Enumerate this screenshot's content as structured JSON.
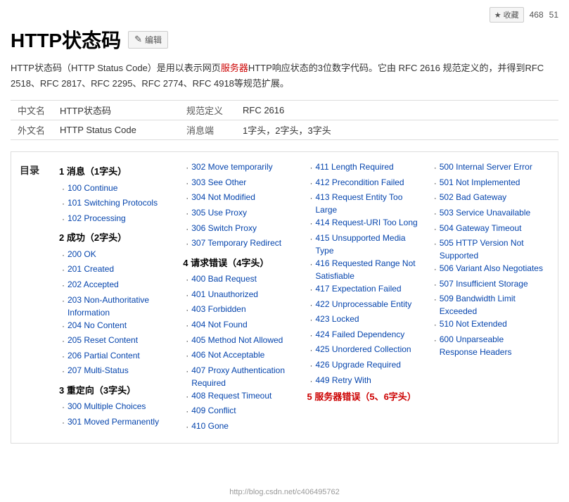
{
  "topbar": {
    "collect_label": "收藏",
    "collect_count": "468",
    "comment_count": "51"
  },
  "header": {
    "title": "HTTP状态码",
    "edit_label": "编辑"
  },
  "description": {
    "text1": "HTTP状态码（HTTP Status Code）是用以表示网页",
    "server_link": "服务器",
    "text2": "HTTP响应状态的3位数字代码。它由 RFC 2616 规范定义的，并得到RFC 2518、RFC 2817、RFC 2295、RFC 2774、RFC 4918等规范扩展。"
  },
  "info_rows": [
    {
      "label": "中文名",
      "value": "HTTP状态码",
      "meta_label": "规范定义",
      "meta_value": "RFC 2616"
    },
    {
      "label": "外文名",
      "value": "HTTP Status Code",
      "meta_label": "消息端",
      "meta_value": "1字头，2字头，3字头"
    }
  ],
  "toc_label": "目录",
  "columns": [
    {
      "sections": [
        {
          "header": "1 消息（1字头）",
          "items": [
            "100 Continue",
            "101 Switching Protocols",
            "102 Processing"
          ]
        },
        {
          "header": "2 成功（2字头）",
          "items": [
            "200 OK",
            "201 Created",
            "202 Accepted",
            "203 Non-Authoritative Information",
            "204 No Content",
            "205 Reset Content",
            "206 Partial Content",
            "207 Multi-Status"
          ]
        },
        {
          "header": "3 重定向（3字头）",
          "items": [
            "300 Multiple Choices",
            "301 Moved Permanently"
          ]
        }
      ]
    },
    {
      "sections": [
        {
          "header": "",
          "items": [
            "302 Move temporarily",
            "303 See Other",
            "304 Not Modified",
            "305 Use Proxy",
            "306 Switch Proxy",
            "307 Temporary Redirect"
          ]
        },
        {
          "header": "4 请求错误（4字头）",
          "items": [
            "400 Bad Request",
            "401 Unauthorized",
            "403 Forbidden",
            "404 Not Found",
            "405 Method Not Allowed",
            "406 Not Acceptable",
            "407 Proxy Authentication Required",
            "408 Request Timeout",
            "409 Conflict",
            "410 Gone"
          ]
        }
      ]
    },
    {
      "sections": [
        {
          "header": "",
          "items": [
            "411 Length Required",
            "412 Precondition Failed",
            "413 Request Entity Too Large",
            "414 Request-URI Too Long",
            "415 Unsupported Media Type",
            "416 Requested Range Not Satisfiable",
            "417 Expectation Failed",
            "422 Unprocessable Entity",
            "423 Locked",
            "424 Failed Dependency",
            "425 Unordered Collection",
            "426 Upgrade Required",
            "449 Retry With"
          ]
        },
        {
          "header": "5 服务器错误（5、6字头）",
          "items": []
        }
      ]
    },
    {
      "sections": [
        {
          "header": "",
          "items": [
            "500 Internal Server Error",
            "501 Not Implemented",
            "502 Bad Gateway",
            "503 Service Unavailable",
            "504 Gateway Timeout",
            "505 HTTP Version Not Supported",
            "506 Variant Also Negotiates",
            "507 Insufficient Storage",
            "509 Bandwidth Limit Exceeded",
            "510 Not Extended",
            "600 Unparseable Response Headers"
          ]
        }
      ]
    }
  ],
  "watermark": "http://blog.csdn.net/c406495762"
}
